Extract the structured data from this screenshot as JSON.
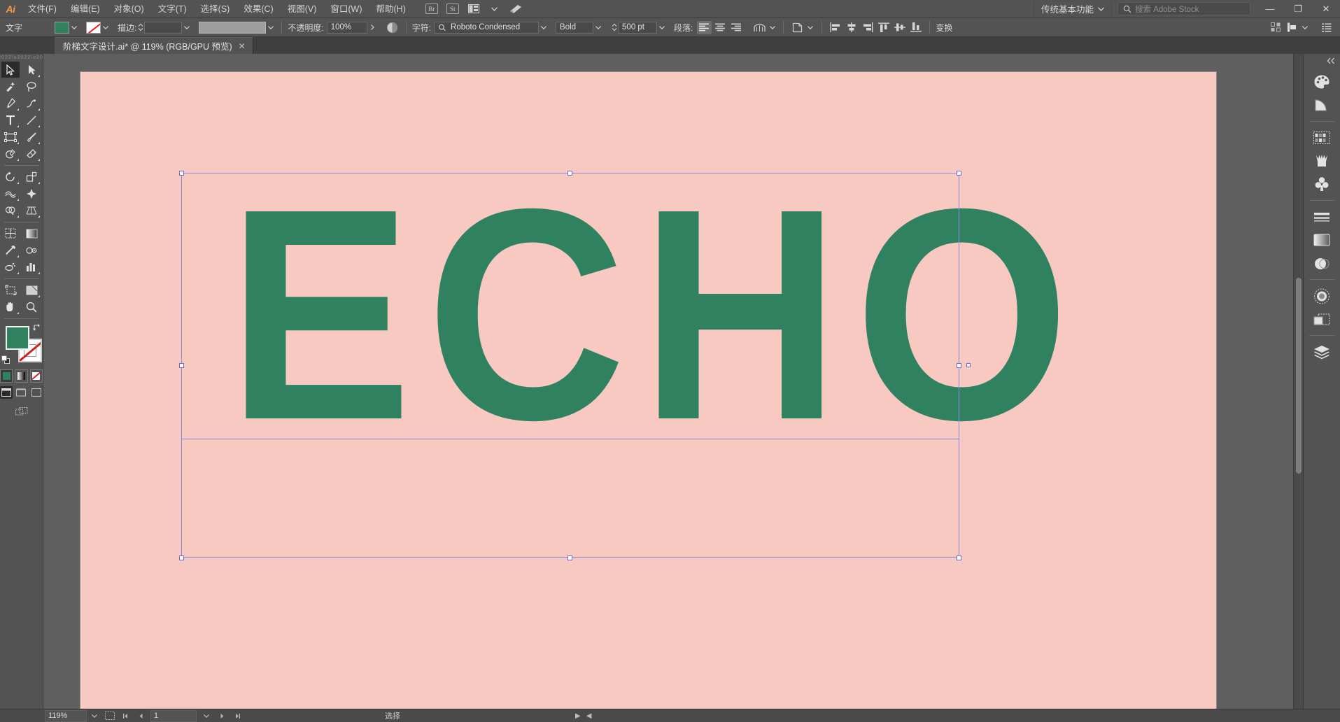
{
  "app": {
    "name": "Adobe Illustrator",
    "logo_text": "Ai"
  },
  "menubar": {
    "items": [
      {
        "label": "文件(F)"
      },
      {
        "label": "编辑(E)"
      },
      {
        "label": "对象(O)"
      },
      {
        "label": "文字(T)"
      },
      {
        "label": "选择(S)"
      },
      {
        "label": "效果(C)"
      },
      {
        "label": "视图(V)"
      },
      {
        "label": "窗口(W)"
      },
      {
        "label": "帮助(H)"
      }
    ],
    "bridge_label": "Br",
    "stock_label": "St",
    "arrange_icon": "arrange-documents-icon",
    "sync_icon": "sync-settings-icon",
    "workspace": "传统基本功能",
    "search_placeholder": "搜索 Adobe Stock",
    "window_buttons": {
      "minimize": "—",
      "maximize": "❐",
      "close": "✕"
    }
  },
  "optionsbar": {
    "context_label": "文字",
    "fill_color": "#2f8160",
    "stroke_color": "none",
    "stroke_label": "描边:",
    "stroke_weight": "",
    "stroke_profile": "",
    "opacity_label": "不透明度:",
    "opacity_value": "100%",
    "char_label": "字符:",
    "font_family": "Roboto Condensed",
    "font_style": "Bold",
    "font_size": "500 pt",
    "paragraph_label": "段落:",
    "transform_label": "变换",
    "align_buttons": [
      "align-left",
      "align-center",
      "align-right"
    ],
    "distribute_buttons": [
      "align-left-edges",
      "align-horizontal-center",
      "align-right-edges",
      "align-top-edges",
      "align-vertical-center",
      "align-bottom-edges"
    ]
  },
  "tabbar": {
    "document_title": "阶梯文字设计.ai* @ 119% (RGB/GPU 预览)",
    "close_glyph": "✕"
  },
  "toolbar": {
    "tools": [
      {
        "name": "selection-tool",
        "glyph": "selection",
        "selected": true,
        "has_flyout": false
      },
      {
        "name": "direct-selection-tool",
        "glyph": "direct-selection",
        "selected": false,
        "has_flyout": true
      },
      {
        "name": "magic-wand-tool",
        "glyph": "magic-wand",
        "selected": false,
        "has_flyout": false
      },
      {
        "name": "lasso-tool",
        "glyph": "lasso",
        "selected": false,
        "has_flyout": false
      },
      {
        "name": "pen-tool",
        "glyph": "pen",
        "selected": false,
        "has_flyout": true
      },
      {
        "name": "curvature-tool",
        "glyph": "curvature",
        "selected": false,
        "has_flyout": false
      },
      {
        "name": "type-tool",
        "glyph": "type",
        "selected": false,
        "has_flyout": true
      },
      {
        "name": "line-segment-tool",
        "glyph": "line",
        "selected": false,
        "has_flyout": true
      },
      {
        "name": "rectangle-tool",
        "glyph": "rectangle",
        "selected": false,
        "has_flyout": true
      },
      {
        "name": "paintbrush-tool",
        "glyph": "paintbrush",
        "selected": false,
        "has_flyout": true
      },
      {
        "name": "shaper-tool",
        "glyph": "shaper",
        "selected": false,
        "has_flyout": true
      },
      {
        "name": "eraser-tool",
        "glyph": "eraser",
        "selected": false,
        "has_flyout": true
      },
      {
        "name": "rotate-tool",
        "glyph": "rotate",
        "selected": false,
        "has_flyout": true
      },
      {
        "name": "scale-tool",
        "glyph": "scale",
        "selected": false,
        "has_flyout": true
      },
      {
        "name": "width-tool",
        "glyph": "width",
        "selected": false,
        "has_flyout": true
      },
      {
        "name": "free-transform-tool",
        "glyph": "free-transform",
        "selected": false,
        "has_flyout": false
      },
      {
        "name": "shape-builder-tool",
        "glyph": "shape-builder",
        "selected": false,
        "has_flyout": true
      },
      {
        "name": "perspective-grid-tool",
        "glyph": "perspective",
        "selected": false,
        "has_flyout": true
      },
      {
        "name": "mesh-tool",
        "glyph": "mesh",
        "selected": false,
        "has_flyout": false
      },
      {
        "name": "gradient-tool",
        "glyph": "gradient",
        "selected": false,
        "has_flyout": false
      },
      {
        "name": "eyedropper-tool",
        "glyph": "eyedropper",
        "selected": false,
        "has_flyout": true
      },
      {
        "name": "blend-tool",
        "glyph": "blend",
        "selected": false,
        "has_flyout": false
      },
      {
        "name": "symbol-sprayer-tool",
        "glyph": "symbol-sprayer",
        "selected": false,
        "has_flyout": true
      },
      {
        "name": "column-graph-tool",
        "glyph": "column-graph",
        "selected": false,
        "has_flyout": true
      },
      {
        "name": "artboard-tool",
        "glyph": "artboard",
        "selected": false,
        "has_flyout": false
      },
      {
        "name": "slice-tool",
        "glyph": "slice",
        "selected": false,
        "has_flyout": true
      },
      {
        "name": "hand-tool",
        "glyph": "hand",
        "selected": false,
        "has_flyout": true
      },
      {
        "name": "zoom-tool",
        "glyph": "zoom",
        "selected": false,
        "has_flyout": false
      }
    ],
    "fill_color": "#2f8160",
    "stroke_color": "#ffffff",
    "fill_modes": [
      {
        "name": "color-mode",
        "active": true
      },
      {
        "name": "gradient-mode",
        "active": false
      },
      {
        "name": "none-mode",
        "active": false
      }
    ],
    "screen_modes": [
      {
        "name": "normal-screen-mode",
        "active": true
      },
      {
        "name": "full-screen-menu-mode",
        "active": false
      },
      {
        "name": "full-screen-mode",
        "active": false
      }
    ],
    "edit_toolbar": "edit-toolbar-button"
  },
  "canvas": {
    "artwork_text": "ECHO",
    "text_color": "#2f8160",
    "artboard_color": "#f7c9c0",
    "selection_color": "#8a8ae0"
  },
  "right_dock": {
    "collapse_glyph": "«",
    "groups": [
      [
        {
          "name": "color-panel-icon",
          "label": "颜色"
        },
        {
          "name": "color-guide-panel-icon",
          "label": "颜色参考"
        }
      ],
      [
        {
          "name": "swatches-panel-icon",
          "label": "色板"
        },
        {
          "name": "brushes-panel-icon",
          "label": "画笔"
        },
        {
          "name": "symbols-panel-icon",
          "label": "符号"
        }
      ],
      [
        {
          "name": "stroke-panel-icon",
          "label": "描边"
        },
        {
          "name": "gradient-panel-icon",
          "label": "渐变"
        },
        {
          "name": "transparency-panel-icon",
          "label": "透明度"
        }
      ],
      [
        {
          "name": "appearance-panel-icon",
          "label": "外观"
        },
        {
          "name": "graphic-styles-panel-icon",
          "label": "图形样式"
        }
      ],
      [
        {
          "name": "layers-panel-icon",
          "label": "图层"
        }
      ]
    ]
  },
  "statusbar": {
    "zoom_value": "119%",
    "artboard_nav_icon": "artboard-nav-icon",
    "page_value": "1",
    "status_text": "选择",
    "nav_prev": "◀",
    "nav_next": "▶"
  }
}
